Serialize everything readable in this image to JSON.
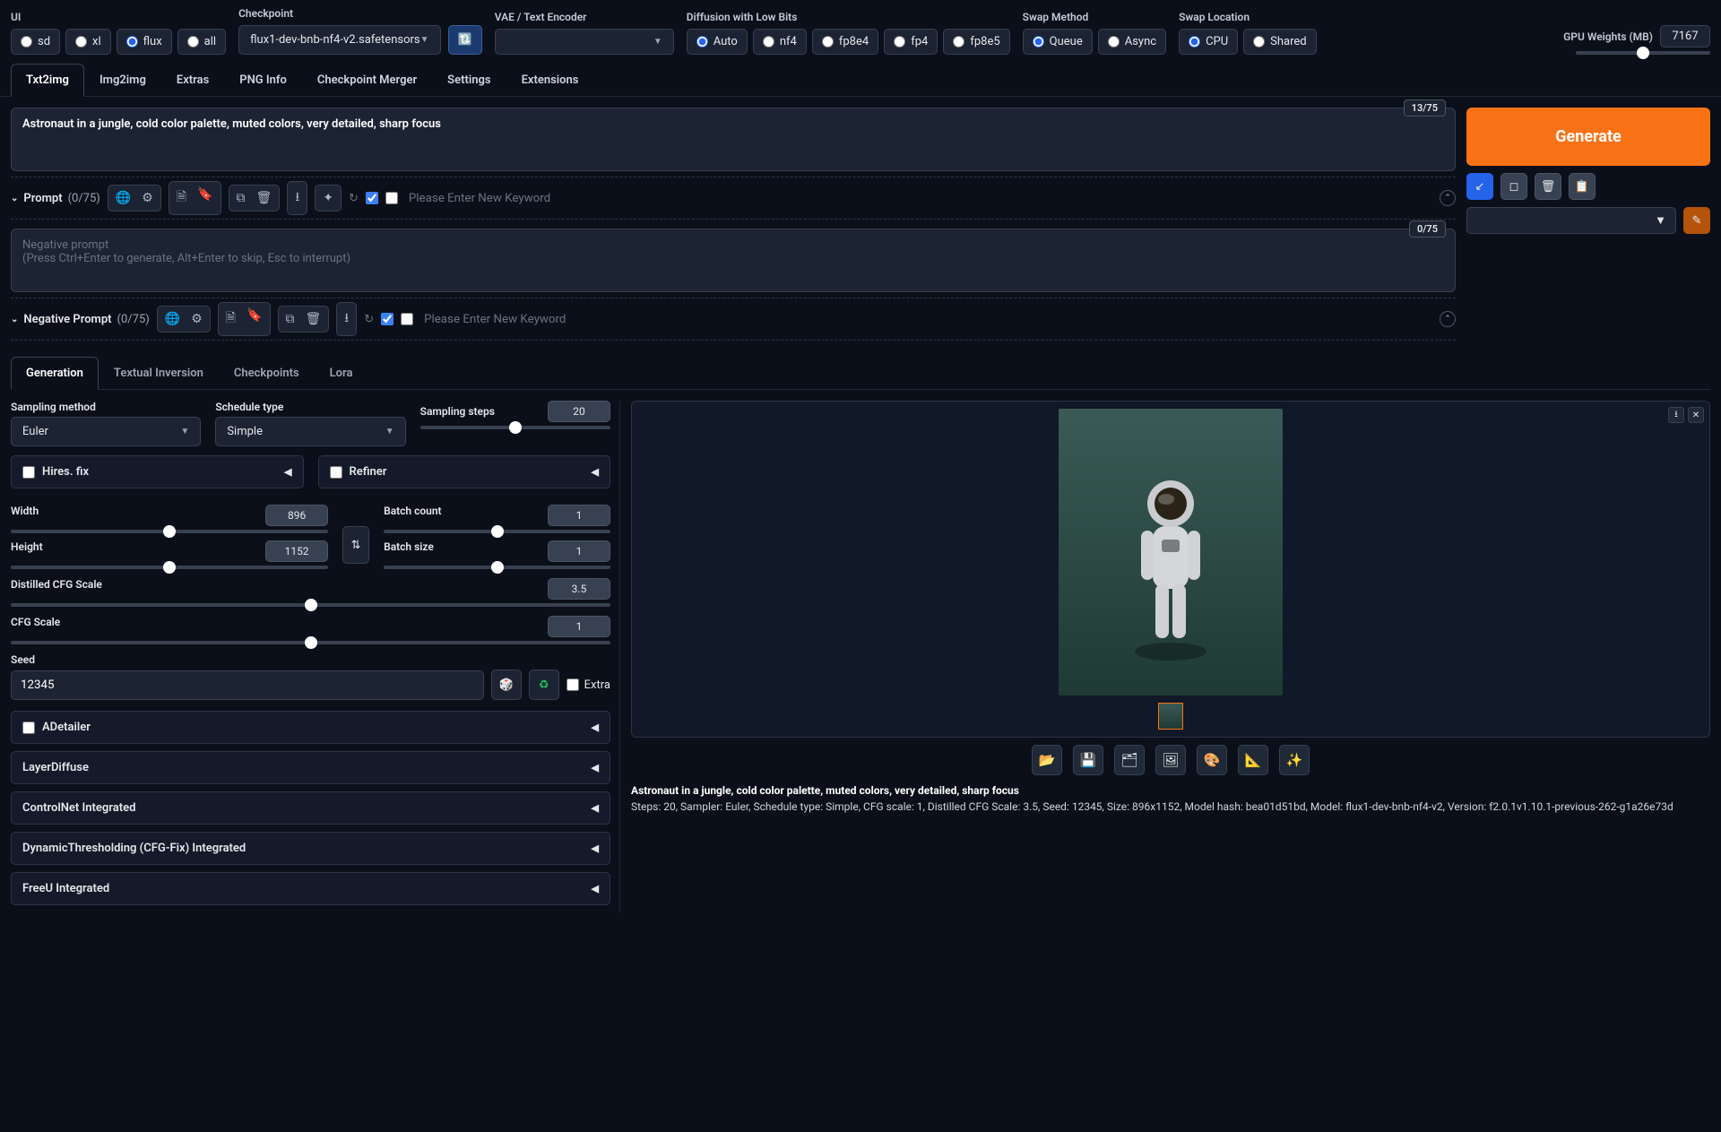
{
  "top": {
    "ui_label": "UI",
    "ui_options": [
      "sd",
      "xl",
      "flux",
      "all"
    ],
    "ui_selected": "flux",
    "checkpoint_label": "Checkpoint",
    "checkpoint_value": "flux1-dev-bnb-nf4-v2.safetensors",
    "vae_label": "VAE / Text Encoder",
    "vae_value": "",
    "diffusion_label": "Diffusion with Low Bits",
    "diffusion_options": [
      "Auto",
      "nf4",
      "fp8e4",
      "fp4",
      "fp8e5"
    ],
    "diffusion_selected": "Auto",
    "swapmethod_label": "Swap Method",
    "swapmethod_options": [
      "Queue",
      "Async"
    ],
    "swapmethod_selected": "Queue",
    "swaplocation_label": "Swap Location",
    "swaplocation_options": [
      "CPU",
      "Shared"
    ],
    "swaplocation_selected": "CPU",
    "gpu_label": "GPU Weights (MB)",
    "gpu_value": "7167"
  },
  "tabs": [
    "Txt2img",
    "Img2img",
    "Extras",
    "PNG Info",
    "Checkpoint Merger",
    "Settings",
    "Extensions"
  ],
  "active_tab": "Txt2img",
  "prompt": {
    "value": "Astronaut in a jungle, cold color palette, muted colors, very detailed, sharp focus",
    "token_count": "13/75",
    "label": "Prompt",
    "count": "(0/75)",
    "keyword_placeholder": "Please Enter New Keyword"
  },
  "neg_prompt": {
    "placeholder": "Negative prompt\n(Press Ctrl+Enter to generate, Alt+Enter to skip, Esc to interrupt)",
    "token_count": "0/75",
    "label": "Negative Prompt",
    "count": "(0/75)",
    "keyword_placeholder": "Please Enter New Keyword"
  },
  "generate": "Generate",
  "sub_tabs": [
    "Generation",
    "Textual Inversion",
    "Checkpoints",
    "Lora"
  ],
  "active_sub_tab": "Generation",
  "gen": {
    "sampling_method_label": "Sampling method",
    "sampling_method": "Euler",
    "schedule_label": "Schedule type",
    "schedule": "Simple",
    "steps_label": "Sampling steps",
    "steps": "20",
    "hires_label": "Hires. fix",
    "refiner_label": "Refiner",
    "width_label": "Width",
    "width": "896",
    "height_label": "Height",
    "height": "1152",
    "batch_count_label": "Batch count",
    "batch_count": "1",
    "batch_size_label": "Batch size",
    "batch_size": "1",
    "dcfg_label": "Distilled CFG Scale",
    "dcfg": "3.5",
    "cfg_label": "CFG Scale",
    "cfg": "1",
    "seed_label": "Seed",
    "seed": "12345",
    "extra_label": "Extra",
    "accordions": [
      "ADetailer",
      "LayerDiffuse",
      "ControlNet Integrated",
      "DynamicThresholding (CFG-Fix) Integrated",
      "FreeU Integrated"
    ]
  },
  "output": {
    "info_prompt": "Astronaut in a jungle, cold color palette, muted colors, very detailed, sharp focus",
    "info_params": "Steps: 20, Sampler: Euler, Schedule type: Simple, CFG scale: 1, Distilled CFG Scale: 3.5, Seed: 12345, Size: 896x1152, Model hash: bea01d51bd, Model: flux1-dev-bnb-nf4-v2, Version: f2.0.1v1.10.1-previous-262-g1a26e73d"
  }
}
